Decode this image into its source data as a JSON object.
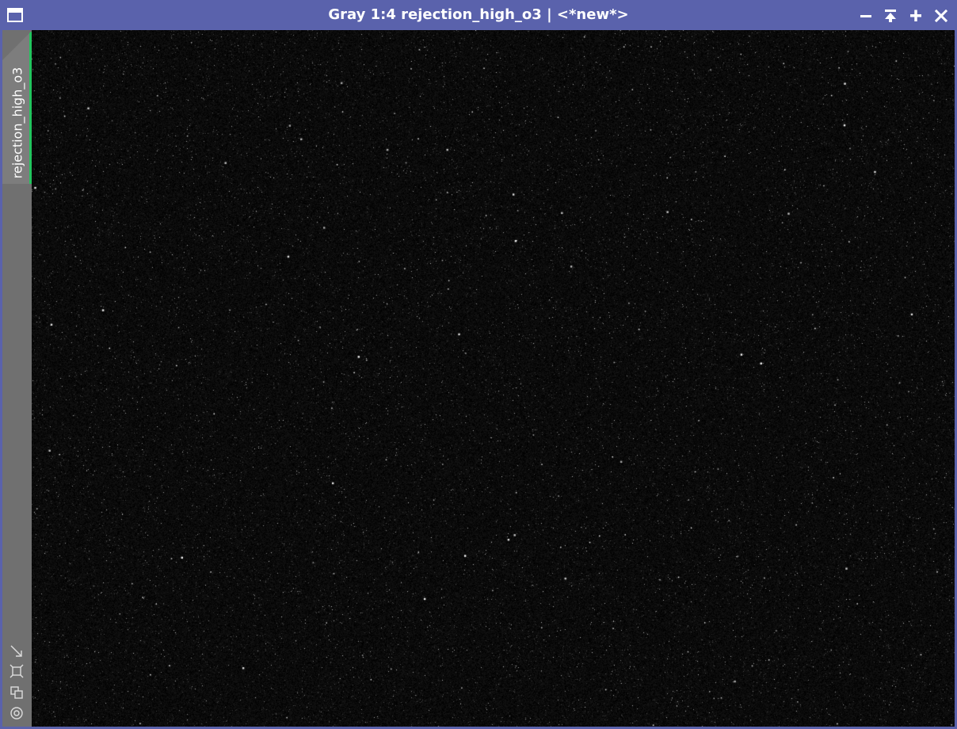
{
  "window": {
    "title": "Gray 1:4 rejection_high_o3 | <*new*>",
    "view_id": "rejection_high_o3",
    "accent_color": "#5a62ac",
    "tab_indicator_color": "#22c55e"
  },
  "titlebar_buttons": [
    {
      "name": "minimize-button",
      "icon": "minus-icon"
    },
    {
      "name": "shade-button",
      "icon": "shade-icon"
    },
    {
      "name": "maximize-button",
      "icon": "plus-icon"
    },
    {
      "name": "close-button",
      "icon": "close-icon"
    }
  ],
  "sidebar_icons": [
    {
      "name": "zoom-to-fit-icon"
    },
    {
      "name": "fit-view-icon"
    },
    {
      "name": "clone-view-icon"
    },
    {
      "name": "preview-icon"
    }
  ]
}
